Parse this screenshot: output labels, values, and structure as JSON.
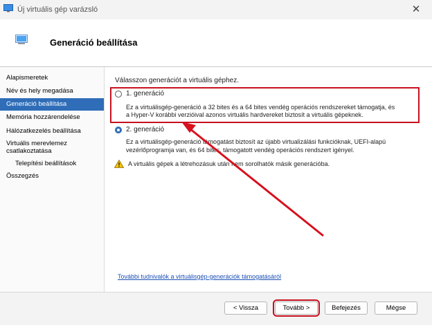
{
  "window": {
    "title": "Új virtuális gép varázsló"
  },
  "header": {
    "title": "Generáció beállítása"
  },
  "sidebar": {
    "items": [
      {
        "label": "Alapismeretek"
      },
      {
        "label": "Név és hely megadása"
      },
      {
        "label": "Generáció beállítása"
      },
      {
        "label": "Memória hozzárendelése"
      },
      {
        "label": "Hálózatkezelés beállítása"
      },
      {
        "label": "Virtuális merevlemez"
      },
      {
        "label": "csatlakoztatása"
      },
      {
        "label": "Telepítési beállítások"
      },
      {
        "label": "Összegzés"
      }
    ]
  },
  "main": {
    "prompt": "Válasszon generációt a virtuális géphez.",
    "gen1": {
      "label": "1. generáció",
      "desc1": "Ez a virtuálisgép-generáció a 32 bites és a 64 bites vendég operációs rendszereket támogatja, és",
      "desc2": "a Hyper-V korábbi verzióival azonos virtuális hardvereket biztosít a virtuális gépeknek."
    },
    "gen2": {
      "label": "2. generáció",
      "desc1": "Ez a virtuálisgép-generáció támogatást biztosít az újabb virtualizálási funkcióknak, UEFI-alapú",
      "desc2": "vezérlőprogramja van, és 64 bites, támogatott vendég operációs rendszert igényel."
    },
    "warning": "A virtuális gépek a létrehozásuk után nem sorolhatók másik generációba.",
    "link": "További tudnivalók a virtuálisgép-generációk támogatásáról"
  },
  "footer": {
    "back": "< Vissza",
    "next": "Tovább >",
    "finish": "Befejezés",
    "cancel": "Mégse"
  },
  "colors": {
    "accent": "#2f6db8",
    "annotation": "#c8101e"
  },
  "icons": {
    "close": "close-icon",
    "warning": "warning-icon"
  }
}
